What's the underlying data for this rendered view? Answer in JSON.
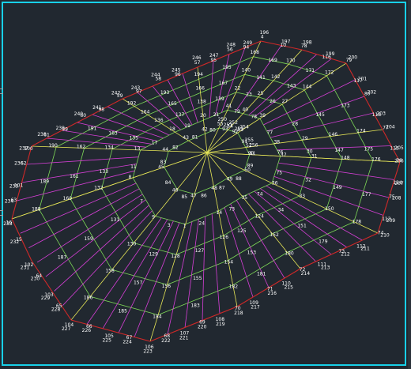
{
  "colors": {
    "background": "#212830",
    "frame": "#18d0e8",
    "boundary": "#d02828",
    "green_lines": "#7ed957",
    "magenta_lines": "#d63fd6",
    "yellow_lines": "#e6e657",
    "labels": "#ffffff"
  },
  "labels": [
    "4",
    "10",
    "78",
    "116",
    "79",
    "117",
    "80",
    "118",
    "77",
    "115",
    "76",
    "114",
    "75",
    "113",
    "74",
    "112",
    "73",
    "111",
    "72",
    "110",
    "71",
    "109",
    "70",
    "108",
    "69",
    "107",
    "68",
    "106",
    "67",
    "105",
    "66",
    "104",
    "65",
    "103",
    "64",
    "102",
    "15",
    "16",
    "63",
    "101",
    "62",
    "100",
    "61",
    "99",
    "60",
    "98",
    "59",
    "97",
    "58",
    "96",
    "57",
    "95",
    "56",
    "94",
    "55",
    "93",
    "54",
    "92",
    "53",
    "91",
    "52",
    "90",
    "51",
    "89",
    "50",
    "88",
    "49",
    "87",
    "48",
    "86",
    "47",
    "85",
    "46",
    "84",
    "45",
    "83",
    "44",
    "82",
    "43",
    "81",
    "42",
    "80",
    "41",
    "79",
    "40",
    "78",
    "39",
    "77",
    "38",
    "76",
    "37",
    "75",
    "36",
    "74",
    "35",
    "73",
    "14",
    "24",
    "1",
    "3",
    "9",
    "7",
    "8",
    "11",
    "13",
    "17",
    "18",
    "19",
    "20",
    "21",
    "22",
    "23",
    "25",
    "26",
    "27",
    "28",
    "29",
    "30",
    "31",
    "32",
    "33",
    "34",
    "124",
    "125",
    "126",
    "127",
    "128",
    "129",
    "130",
    "131",
    "132",
    "133",
    "134",
    "135",
    "136",
    "137",
    "138",
    "139",
    "140",
    "141",
    "142",
    "143",
    "144",
    "145",
    "146",
    "147",
    "148",
    "149",
    "150",
    "151",
    "152",
    "153",
    "154",
    "155",
    "156",
    "157",
    "158",
    "159",
    "160",
    "161",
    "162",
    "163",
    "164",
    "165",
    "166",
    "167",
    "168",
    "169",
    "170",
    "171",
    "172",
    "173",
    "174",
    "175",
    "176",
    "177",
    "178",
    "179",
    "180",
    "181",
    "182",
    "183",
    "184",
    "185",
    "186",
    "187",
    "188",
    "189",
    "190",
    "191",
    "192",
    "193",
    "194",
    "195",
    "196",
    "197",
    "198",
    "199",
    "200",
    "201",
    "202",
    "203",
    "204",
    "205",
    "206",
    "207",
    "208",
    "209",
    "210",
    "211",
    "212",
    "213",
    "214",
    "215",
    "216",
    "217",
    "218",
    "219",
    "220",
    "221",
    "222",
    "223",
    "224",
    "225",
    "226",
    "227",
    "228",
    "229",
    "230",
    "231",
    "232",
    "233",
    "234",
    "235",
    "236",
    "237",
    "238",
    "239",
    "240",
    "241",
    "242",
    "243",
    "244",
    "245",
    "246",
    "247",
    "248",
    "249",
    "250",
    "251",
    "252",
    "253",
    "254",
    "255",
    "256"
  ]
}
